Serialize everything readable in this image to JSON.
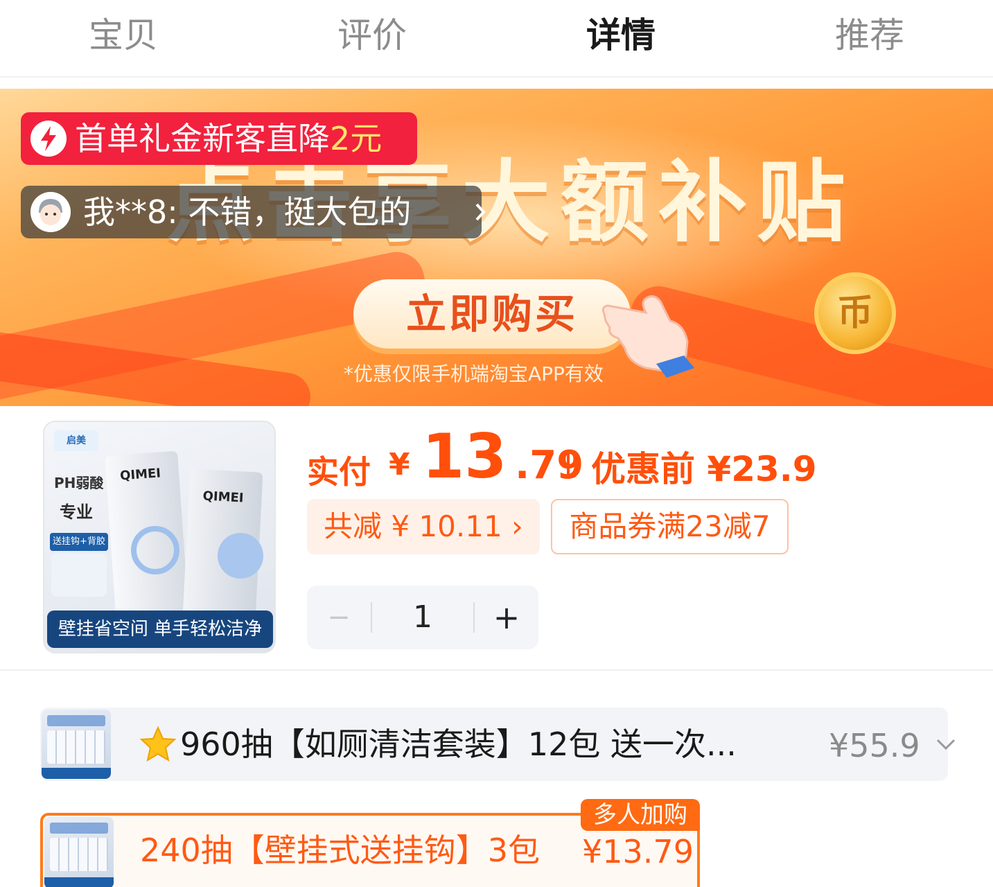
{
  "tabs": [
    {
      "label": "宝贝",
      "active": false
    },
    {
      "label": "评价",
      "active": false
    },
    {
      "label": "详情",
      "active": true
    },
    {
      "label": "推荐",
      "active": false
    }
  ],
  "banner": {
    "headline": "点击享大额补贴",
    "buy_button": "立即购买",
    "note": "*优惠仅限手机端淘宝APP有效",
    "coin_glyph": "币",
    "promo": {
      "text": "首单礼金新客直降",
      "amount": "2元",
      "icon": "lightning-icon",
      "color": "#f2213d"
    },
    "review": {
      "text": "我**8: 不错，挺大包的",
      "icon": "avatar",
      "chevron": "chevron-right-icon"
    }
  },
  "product": {
    "image": {
      "brand": "启美",
      "ph_label": "PH弱酸",
      "pro_label": "专业",
      "gift_label": "送挂钩+背胶",
      "pack_label": "QIMEI",
      "caption": "壁挂省空间 单手轻松洁净"
    },
    "price": {
      "label": "实付",
      "currency": "¥",
      "integer": "13",
      "decimal": ".79",
      "original": "优惠前 ¥23.9",
      "accent_color": "#ff4f0a"
    },
    "savings_chip": "共减 ¥ 10.11 ›",
    "coupon_chip": "商品券满23减7",
    "quantity": {
      "minus": "−",
      "value": "1",
      "plus": "+"
    }
  },
  "skus": [
    {
      "name": "960抽【如厕清洁套装】12包 送一次...",
      "price": "¥55.9",
      "icon": "star-icon",
      "expand_icon": "chevron-down-icon",
      "selected": false
    },
    {
      "name": "240抽【壁挂式送挂钩】3包",
      "price": "¥13.79",
      "badge": "多人加购",
      "selected": true
    }
  ]
}
